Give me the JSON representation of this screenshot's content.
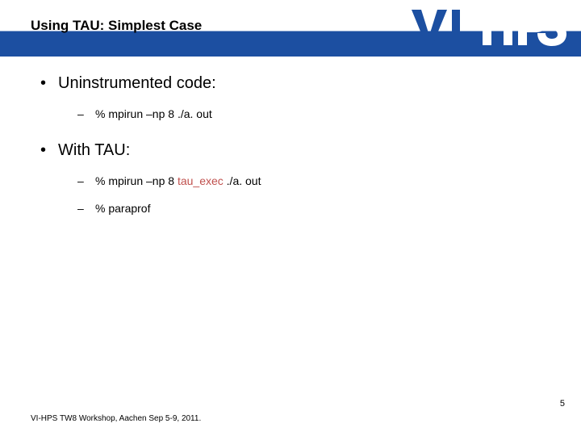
{
  "header": {
    "title": "Using TAU: Simplest Case",
    "logo_alt": "VI-HPS"
  },
  "bullets": {
    "b1": "Uninstrumented code:",
    "b1a_prefix": "% mpirun –np 8  ./a. out",
    "b2": "With TAU:",
    "b2a_prefix": "% mpirun –np 8 ",
    "b2a_hl": "tau_exec",
    "b2a_suffix": "  ./a. out",
    "b2b": "% paraprof"
  },
  "footer": "VI-HPS TW8 Workshop, Aachen Sep 5-9, 2011.",
  "page_number": "5"
}
